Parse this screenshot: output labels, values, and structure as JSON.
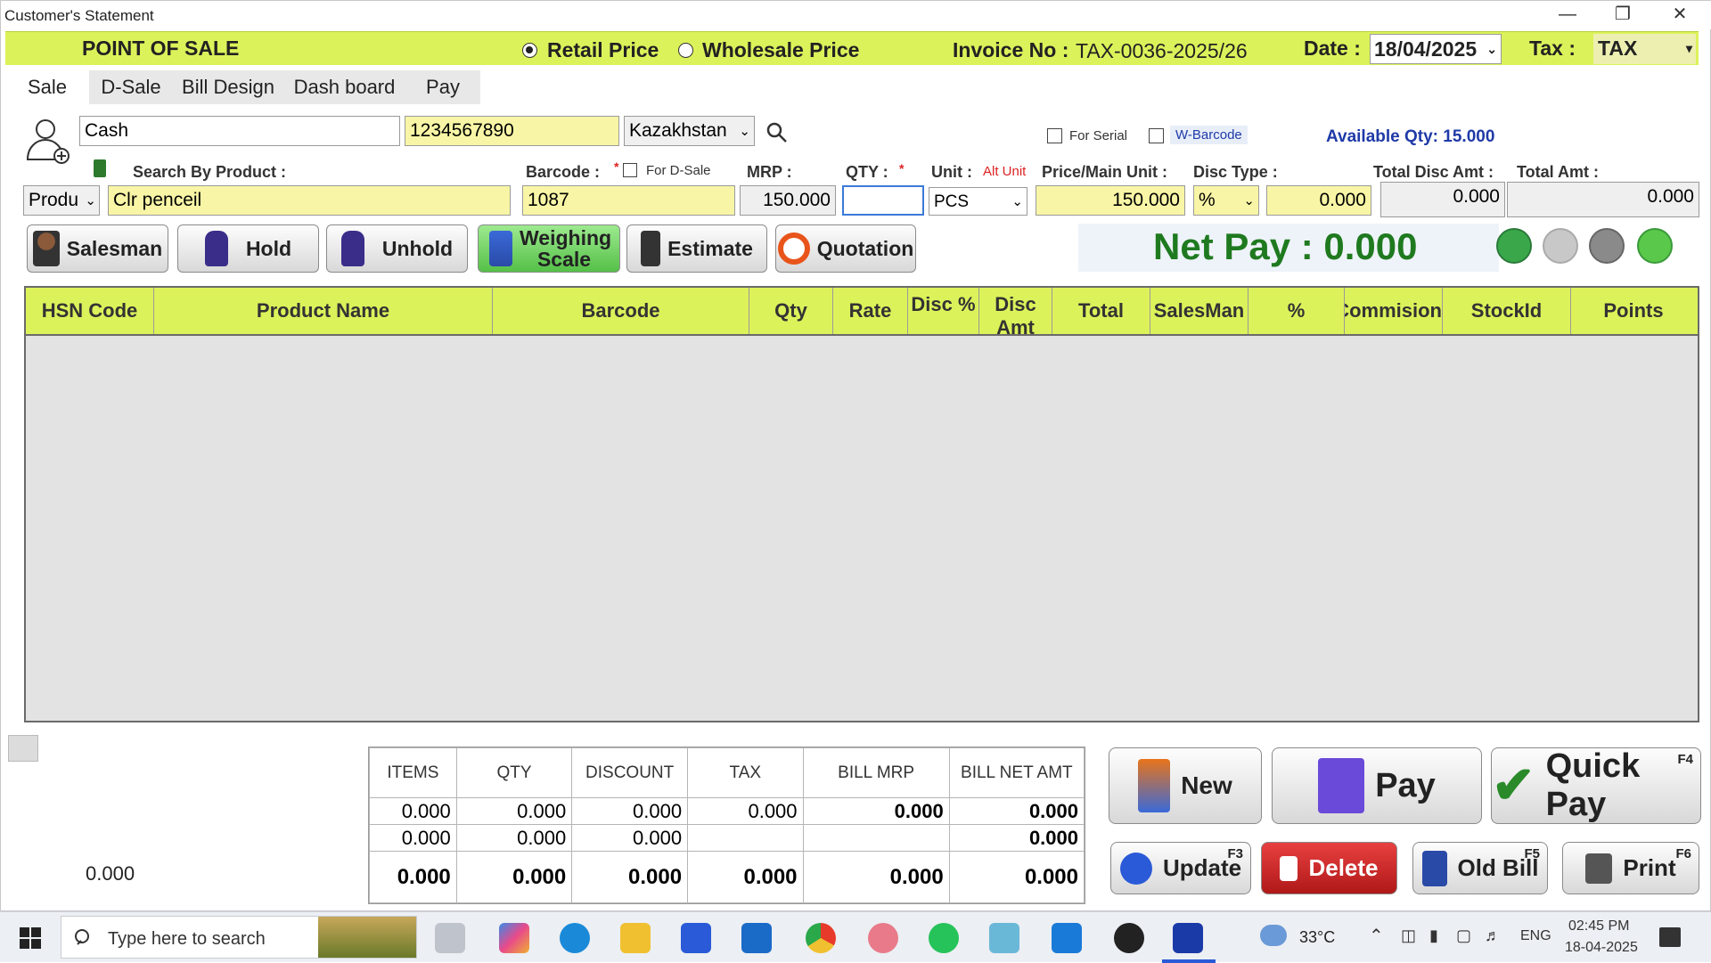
{
  "window": {
    "title": "Customer's Statement"
  },
  "header": {
    "app_label": "POINT OF SALE",
    "retail_price": "Retail Price",
    "wholesale_price": "Wholesale Price",
    "invoice_label": "Invoice No :",
    "invoice_no": "TAX-0036-2025/26",
    "date_label": "Date :",
    "date_value": "18/04/2025",
    "tax_label": "Tax :",
    "tax_value": "TAX"
  },
  "tabs": [
    "Sale",
    "D-Sale",
    "Bill Design",
    "Dash board",
    "Pay"
  ],
  "customer": {
    "name": "Cash",
    "phone": "1234567890",
    "country": "Kazakhstan"
  },
  "options": {
    "for_serial": "For Serial",
    "w_barcode": "W-Barcode",
    "available_qty": "Available Qty: 15.000"
  },
  "fields": {
    "search_label": "Search By Product :",
    "search_mode": "Produ",
    "product": "Clr penceil",
    "barcode_label": "Barcode :",
    "for_dsale": "For D-Sale",
    "barcode": "1087",
    "mrp_label": "MRP :",
    "mrp": "150.000",
    "qty_label": "QTY :",
    "qty": "",
    "unit_label": "Unit :",
    "alt_unit": "Alt Unit",
    "unit": "PCS",
    "price_label": "Price/Main Unit :",
    "price": "150.000",
    "disc_type_label": "Disc Type :",
    "disc_type": "%",
    "disc_value": "0.000",
    "total_disc_label": "Total Disc Amt :",
    "total_disc": "0.000",
    "total_amt_label": "Total Amt :",
    "total_amt": "0.000"
  },
  "actions": {
    "salesman": "Salesman",
    "hold": "Hold",
    "unhold": "Unhold",
    "weighing": "Weighing Scale",
    "estimate": "Estimate",
    "quotation": "Quotation"
  },
  "net_pay": "Net Pay : 0.000",
  "grid_columns": [
    "HSN Code",
    "Product Name",
    "Barcode",
    "Qty",
    "Rate",
    "Disc %",
    "Disc Amt",
    "Total",
    "SalesMan",
    "%",
    "Commision",
    "StockId",
    "Points"
  ],
  "left_total": "0.000",
  "summary": {
    "headers": [
      "ITEMS",
      "QTY",
      "DISCOUNT",
      "TAX",
      "BILL MRP",
      "BILL NET AMT"
    ],
    "row1": [
      "0.000",
      "0.000",
      "0.000",
      "0.000",
      "0.000",
      "0.000"
    ],
    "row2": [
      "0.000",
      "0.000",
      "0.000",
      "",
      "",
      "0.000"
    ],
    "row3": [
      "0.000",
      "0.000",
      "0.000",
      "0.000",
      "0.000",
      "0.000"
    ]
  },
  "bottom_buttons": {
    "new": "New",
    "pay": "Pay",
    "quick_pay": "Quick Pay",
    "quick_pay_key": "F4",
    "update": "Update",
    "update_key": "F3",
    "delete": "Delete",
    "old_bill": "Old Bill",
    "old_bill_key": "F5",
    "print": "Print",
    "print_key": "F6"
  },
  "taskbar": {
    "search_placeholder": "Type here to search",
    "weather": "33°C",
    "lang": "ENG",
    "time": "02:45 PM",
    "date": "18-04-2025"
  },
  "colors": {
    "accent_bar": "#dcf25a",
    "net_pay": "#1f7a1f",
    "available_qty": "#1f3aa8"
  }
}
